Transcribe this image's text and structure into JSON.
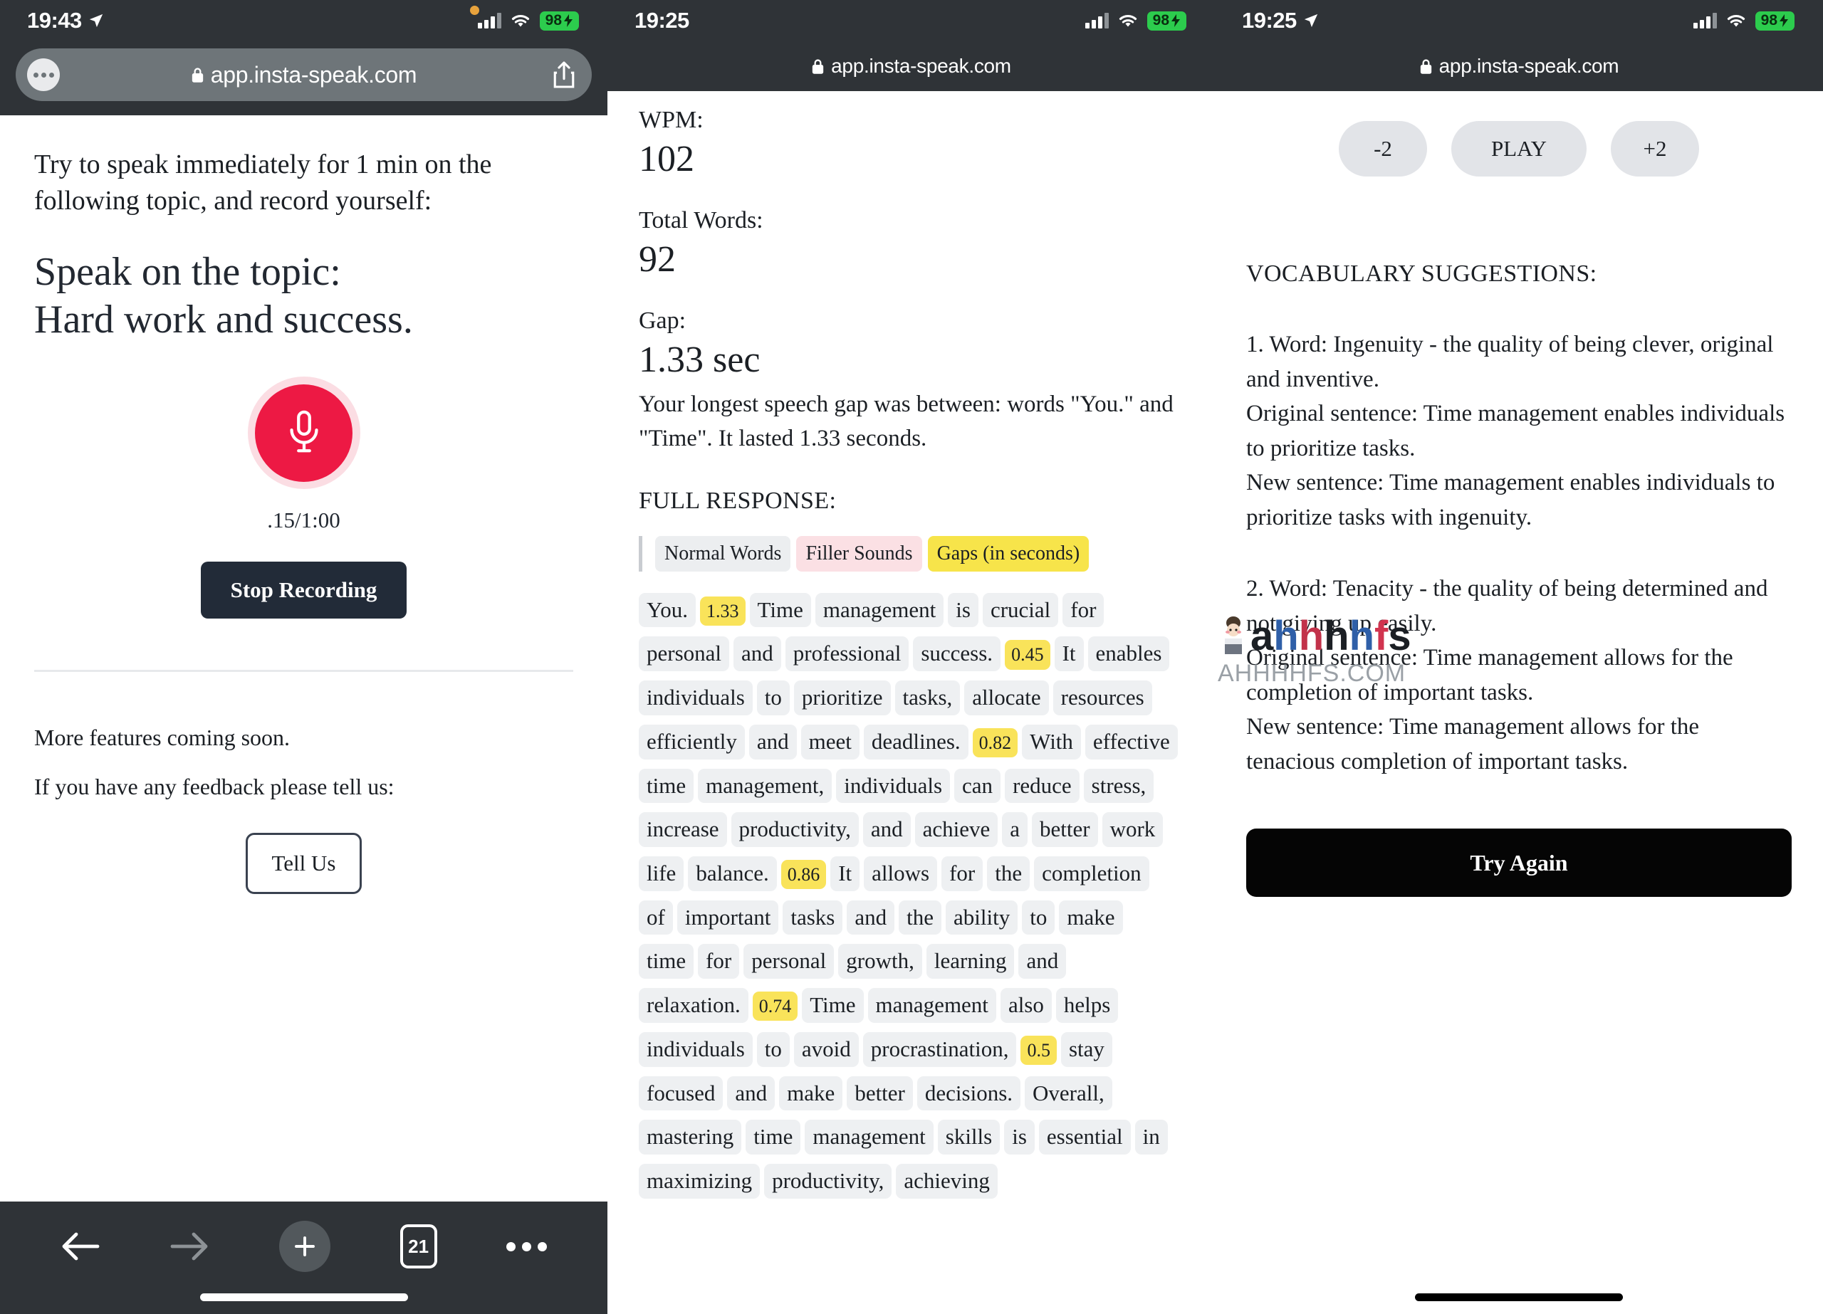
{
  "panel1": {
    "status": {
      "time": "19:43",
      "battery": "98",
      "location_icon": "location-arrow-icon",
      "wifi_icon": "wifi-icon",
      "signal_icon": "cellular-bars-icon"
    },
    "browser": {
      "url": "app.insta-speak.com",
      "lock_icon": "lock-icon",
      "aa_icon": "page-settings-icon",
      "share_icon": "share-icon"
    },
    "prompt": "Try to speak immediately for 1 min on the following topic, and record yourself:",
    "topic": "Speak on the topic:\nHard work and success.",
    "mic_icon": "microphone-icon",
    "timer": ".15/1:00",
    "stop_button": "Stop Recording",
    "more_features": "More features coming soon.",
    "feedback_prompt": "If you have any feedback please tell us:",
    "tell_us_button": "Tell Us",
    "toolbar": {
      "back_icon": "back-arrow-icon",
      "forward_icon": "forward-arrow-icon",
      "new_tab_icon": "plus-icon",
      "tab_count": "21",
      "more_icon": "more-dots-icon"
    }
  },
  "panel2": {
    "status": {
      "time": "19:25",
      "battery": "98",
      "wifi_icon": "wifi-icon",
      "signal_icon": "cellular-bars-icon"
    },
    "browser": {
      "url": "app.insta-speak.com",
      "lock_icon": "lock-icon"
    },
    "stats": [
      {
        "label": "WPM:",
        "value": "102"
      },
      {
        "label": "Total Words:",
        "value": "92"
      },
      {
        "label": "Gap:",
        "value": "1.33 sec"
      }
    ],
    "gap_description": "Your longest speech gap was between: words \"You.\" and \"Time\". It lasted 1.33 seconds.",
    "full_response_head": "FULL RESPONSE:",
    "legend": {
      "normal": "Normal Words",
      "filler": "Filler Sounds",
      "gaps": "Gaps (in seconds)"
    },
    "colors": {
      "normal_word": "#eef0f2",
      "filler": "#fbe0e4",
      "gap": "#f9e35a",
      "accent_red": "#ed1944",
      "dark": "#222b38"
    },
    "transcript": [
      {
        "t": "You.",
        "k": "w"
      },
      {
        "t": "1.33",
        "k": "g"
      },
      {
        "t": "Time",
        "k": "w"
      },
      {
        "t": "management",
        "k": "w"
      },
      {
        "t": "is",
        "k": "w"
      },
      {
        "t": "crucial",
        "k": "w"
      },
      {
        "t": "for",
        "k": "w"
      },
      {
        "t": "personal",
        "k": "w"
      },
      {
        "t": "and",
        "k": "w"
      },
      {
        "t": "professional",
        "k": "w"
      },
      {
        "t": "success.",
        "k": "w"
      },
      {
        "t": "0.45",
        "k": "g"
      },
      {
        "t": "It",
        "k": "w"
      },
      {
        "t": "enables",
        "k": "w"
      },
      {
        "t": "individuals",
        "k": "w"
      },
      {
        "t": "to",
        "k": "w"
      },
      {
        "t": "prioritize",
        "k": "w"
      },
      {
        "t": "tasks,",
        "k": "w"
      },
      {
        "t": "allocate",
        "k": "w"
      },
      {
        "t": "resources",
        "k": "w"
      },
      {
        "t": "efficiently",
        "k": "w"
      },
      {
        "t": "and",
        "k": "w"
      },
      {
        "t": "meet",
        "k": "w"
      },
      {
        "t": "deadlines.",
        "k": "w"
      },
      {
        "t": "0.82",
        "k": "g"
      },
      {
        "t": "With",
        "k": "w"
      },
      {
        "t": "effective",
        "k": "w"
      },
      {
        "t": "time",
        "k": "w"
      },
      {
        "t": "management,",
        "k": "w"
      },
      {
        "t": "individuals",
        "k": "w"
      },
      {
        "t": "can",
        "k": "w"
      },
      {
        "t": "reduce",
        "k": "w"
      },
      {
        "t": "stress,",
        "k": "w"
      },
      {
        "t": "increase",
        "k": "w"
      },
      {
        "t": "productivity,",
        "k": "w"
      },
      {
        "t": "and",
        "k": "w"
      },
      {
        "t": "achieve",
        "k": "w"
      },
      {
        "t": "a",
        "k": "w"
      },
      {
        "t": "better",
        "k": "w"
      },
      {
        "t": "work",
        "k": "w"
      },
      {
        "t": "life",
        "k": "w"
      },
      {
        "t": "balance.",
        "k": "w"
      },
      {
        "t": "0.86",
        "k": "g"
      },
      {
        "t": "It",
        "k": "w"
      },
      {
        "t": "allows",
        "k": "w"
      },
      {
        "t": "for",
        "k": "w"
      },
      {
        "t": "the",
        "k": "w"
      },
      {
        "t": "completion",
        "k": "w"
      },
      {
        "t": "of",
        "k": "w"
      },
      {
        "t": "important",
        "k": "w"
      },
      {
        "t": "tasks",
        "k": "w"
      },
      {
        "t": "and",
        "k": "w"
      },
      {
        "t": "the",
        "k": "w"
      },
      {
        "t": "ability",
        "k": "w"
      },
      {
        "t": "to",
        "k": "w"
      },
      {
        "t": "make",
        "k": "w"
      },
      {
        "t": "time",
        "k": "w"
      },
      {
        "t": "for",
        "k": "w"
      },
      {
        "t": "personal",
        "k": "w"
      },
      {
        "t": "growth,",
        "k": "w"
      },
      {
        "t": "learning",
        "k": "w"
      },
      {
        "t": "and",
        "k": "w"
      },
      {
        "t": "relaxation.",
        "k": "w"
      },
      {
        "t": "0.74",
        "k": "g"
      },
      {
        "t": "Time",
        "k": "w"
      },
      {
        "t": "management",
        "k": "w"
      },
      {
        "t": "also",
        "k": "w"
      },
      {
        "t": "helps",
        "k": "w"
      },
      {
        "t": "individuals",
        "k": "w"
      },
      {
        "t": "to",
        "k": "w"
      },
      {
        "t": "avoid",
        "k": "w"
      },
      {
        "t": "procrastination,",
        "k": "w"
      },
      {
        "t": "0.5",
        "k": "g"
      },
      {
        "t": "stay",
        "k": "w"
      },
      {
        "t": "focused",
        "k": "w"
      },
      {
        "t": "and",
        "k": "w"
      },
      {
        "t": "make",
        "k": "w"
      },
      {
        "t": "better",
        "k": "w"
      },
      {
        "t": "decisions.",
        "k": "w"
      },
      {
        "t": "Overall,",
        "k": "w"
      },
      {
        "t": "mastering",
        "k": "w"
      },
      {
        "t": "time",
        "k": "w"
      },
      {
        "t": "management",
        "k": "w"
      },
      {
        "t": "skills",
        "k": "w"
      },
      {
        "t": "is",
        "k": "w"
      },
      {
        "t": "essential",
        "k": "w"
      },
      {
        "t": "in",
        "k": "w"
      },
      {
        "t": "maximizing",
        "k": "w"
      },
      {
        "t": "productivity,",
        "k": "w"
      },
      {
        "t": "achieving",
        "k": "w"
      }
    ]
  },
  "panel3": {
    "status": {
      "time": "19:25",
      "battery": "98",
      "location_icon": "location-arrow-icon",
      "wifi_icon": "wifi-icon",
      "signal_icon": "cellular-bars-icon"
    },
    "browser": {
      "url": "app.insta-speak.com",
      "lock_icon": "lock-icon"
    },
    "controls": {
      "minus": "-2",
      "play": "PLAY",
      "plus": "+2"
    },
    "vocab_head": "VOCABULARY SUGGESTIONS:",
    "vocab1": "1. Word: Ingenuity - the quality of being clever, original and inventive.\nOriginal sentence: Time management enables individuals to prioritize tasks.\nNew sentence: Time management enables individuals to prioritize tasks with ingenuity.",
    "vocab2": "2. Word: Tenacity - the quality of being determined and not giving up easily.\nOriginal sentence: Time management allows for the completion of important tasks.\nNew sentence: Time management allows for the tenacious completion of important tasks.",
    "try_again": "Try Again",
    "watermark": "AHHHHFS.COM"
  }
}
